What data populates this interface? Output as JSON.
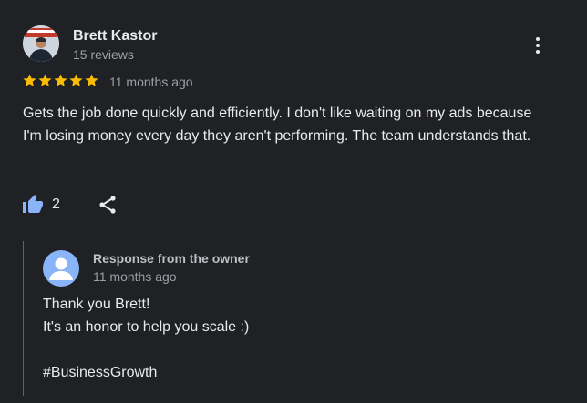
{
  "review": {
    "reviewer_name": "Brett Kastor",
    "review_count": "15 reviews",
    "rating": 5,
    "rating_max": 5,
    "date": "11 months ago",
    "text": "Gets the job done quickly and efficiently. I don't like waiting on my ads because I'm losing money every day they aren't performing. The team understands that.",
    "like_count": "2",
    "more_icon": "more-vert-icon",
    "like_icon": "thumb-up-icon",
    "share_icon": "share-icon",
    "star_color": "#fbbc04"
  },
  "owner_response": {
    "title": "Response from the owner",
    "date": "11 months ago",
    "lines": [
      "Thank you Brett!",
      "It's an honor to help you scale :)",
      "",
      "#BusinessGrowth"
    ],
    "avatar_color": "#8ab4f8"
  },
  "colors": {
    "background": "#202124",
    "text_primary": "#e8eaed",
    "text_secondary": "#9aa0a6",
    "accent_blue": "#8ab4f8"
  }
}
